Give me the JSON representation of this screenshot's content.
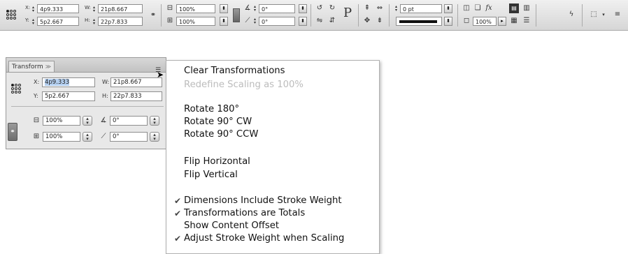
{
  "control_bar": {
    "x_label": "X:",
    "x_value": "4p9.333",
    "y_label": "Y:",
    "y_value": "5p2.667",
    "w_label": "W:",
    "w_value": "21p8.667",
    "h_label": "H:",
    "h_value": "22p7.833",
    "scale_x": "100%",
    "scale_y": "100%",
    "rotation": "0°",
    "shear": "0°",
    "stroke_weight": "0 pt",
    "opacity": "100%"
  },
  "panel": {
    "tab_label": "Transform",
    "x_label": "X:",
    "x_value": "4p9.333",
    "y_label": "Y:",
    "y_value": "5p2.667",
    "w_label": "W:",
    "w_value": "21p8.667",
    "h_label": "H:",
    "h_value": "22p7.833",
    "scale_x": "100%",
    "scale_y": "100%",
    "rotation": "0°",
    "shear": "0°"
  },
  "menu": {
    "items": [
      {
        "label": "Clear Transformations",
        "enabled": true,
        "checked": false
      },
      {
        "label": "Redefine Scaling as 100%",
        "enabled": false,
        "checked": false
      },
      {
        "label": "Rotate 180°",
        "enabled": true,
        "checked": false
      },
      {
        "label": "Rotate 90° CW",
        "enabled": true,
        "checked": false
      },
      {
        "label": "Rotate 90° CCW",
        "enabled": true,
        "checked": false
      },
      {
        "label": "Flip Horizontal",
        "enabled": true,
        "checked": false
      },
      {
        "label": "Flip Vertical",
        "enabled": true,
        "checked": false
      },
      {
        "label": "Dimensions Include Stroke Weight",
        "enabled": true,
        "checked": true
      },
      {
        "label": "Transformations are Totals",
        "enabled": true,
        "checked": true
      },
      {
        "label": "Show Content Offset",
        "enabled": true,
        "checked": false
      },
      {
        "label": "Adjust Stroke Weight when Scaling",
        "enabled": true,
        "checked": true
      }
    ]
  }
}
